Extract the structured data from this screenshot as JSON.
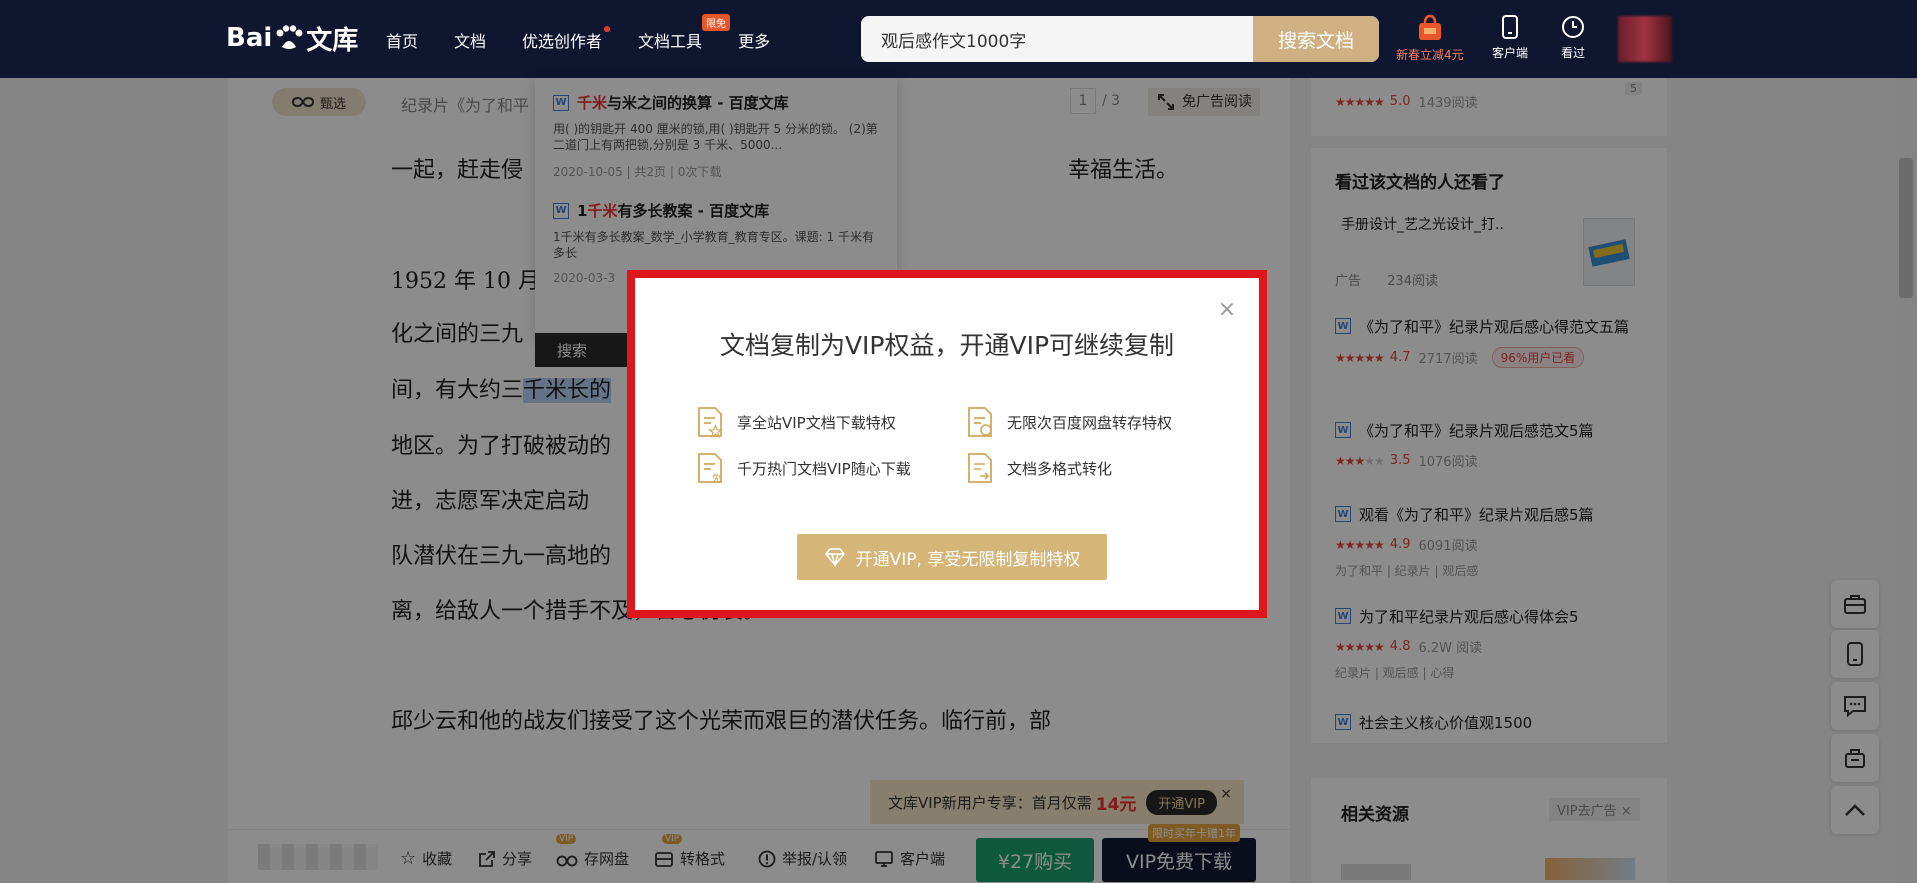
{
  "nav": {
    "logo_text": "Bai",
    "logo_text2": "文库",
    "items": [
      "首页",
      "文档",
      "优选创作者",
      "文档工具",
      "更多"
    ],
    "tool_badge": "限免"
  },
  "search": {
    "value": "观后感作文1000字",
    "button": "搜索文档"
  },
  "top_right": {
    "promo": "新春立减4元",
    "client": "客户端",
    "history": "看过"
  },
  "doc_bar": {
    "chip": "甄选",
    "title": "纪录片《为了和平",
    "page_current": "1",
    "page_total": "/ 3",
    "noad": "免广告阅读"
  },
  "doc": {
    "lines": [
      "一起，赶走侵",
      "1952 年 10 月",
      "化之间的三九",
      "间，有大约三",
      "地区。为了打破被动的",
      "进，志愿军决定启动",
      "队潜伏在三九一高地的",
      "离，给敌人一个措手不及，苦心伪装。",
      "邱少云和他的战友们接受了这个光荣而艰巨的潜伏任务。临行前，部"
    ],
    "fragment_right": "幸福生活。",
    "highlight": "千米长的"
  },
  "popup": {
    "items": [
      {
        "title_red": "千米",
        "title_rest": "与米之间的换算 - 百度文库",
        "desc": "用( )的钥匙开 400 厘米的锁,用( )钥匙开 5 分米的锁。 (2)第二道门上有两把锁,分别是 3 千米、5000...",
        "meta": "2020-10-05 | 共2页 | 0次下载"
      },
      {
        "title_pre": "1",
        "title_red": "千米",
        "title_rest": "有多长教案 - 百度文库",
        "desc": "1千米有多长教案_数学_小学教育_教育专区。课题: 1 千米有多长",
        "meta": "2020-03-3"
      }
    ],
    "search_label": "搜索"
  },
  "modal": {
    "title": "文档复制为VIP权益，开通VIP可继续复制",
    "features": [
      "享全站VIP文档下载特权",
      "无限次百度网盘转存特权",
      "千万热门文档VIP随心下载",
      "文档多格式转化"
    ],
    "cta": "开通VIP, 享受无限制复制特权",
    "close": "×"
  },
  "sidebar": {
    "top_card": {
      "rating": "5.0",
      "reads": "1439阅读",
      "count": "5"
    },
    "also_viewed": {
      "heading": "看过该文档的人还看了",
      "ad_title": "手册设计_艺之光设计_打..",
      "ad_label": "广告",
      "ad_reads": "234阅读",
      "items": [
        {
          "title": "《为了和平》纪录片观后感心得范文五篇",
          "rating": "4.7",
          "reads": "2717阅读",
          "badge": "96%用户已看",
          "tags": ""
        },
        {
          "title": "《为了和平》纪录片观后感范文5篇",
          "rating": "3.5",
          "reads": "1076阅读",
          "badge": "",
          "tags": ""
        },
        {
          "title": "观看《为了和平》纪录片观后感5篇",
          "rating": "4.9",
          "reads": "6091阅读",
          "badge": "",
          "tags": "为了和平 | 纪录片 | 观后感"
        },
        {
          "title": "为了和平纪录片观后感心得体会5",
          "rating": "4.8",
          "reads": "6.2W 阅读",
          "badge": "",
          "tags": "纪录片 | 观后感 | 心得"
        },
        {
          "title": "社会主义核心价值观1500",
          "rating": "",
          "reads": "",
          "badge": "",
          "tags": ""
        }
      ]
    },
    "related": {
      "heading": "相关资源",
      "vip_noad": "VIP去广告 ×"
    }
  },
  "newuser": {
    "text": "文库VIP新用户专享：首月仅需",
    "price": "14元",
    "open": "开通VIP",
    "close": "×"
  },
  "bottom": {
    "collect": "收藏",
    "share": "分享",
    "pan": "存网盘",
    "convert": "转格式",
    "report": "举报/认领",
    "client": "客户端",
    "buy": "¥27购买",
    "vip_download": "VIP免费下载",
    "vip_tag": "限时买年卡赠1年",
    "small_vip": "VIP"
  }
}
